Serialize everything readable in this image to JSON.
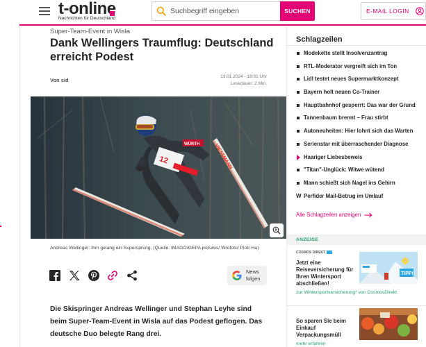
{
  "header": {
    "brand_name": "t-online",
    "brand_tagline": "Nachrichten für Deutschland",
    "search_placeholder": "Suchbegriff eingeben",
    "search_button": "SUCHEN",
    "login_label": "E-MAIL LOGIN",
    "brand_color": "#e20074"
  },
  "article": {
    "kicker": "Super-Team-Event in Wisla",
    "headline": "Dank Wellingers Traumflug: Deutschland erreicht Podest",
    "author": "Von sid",
    "date": "13.01.2024 - 18:01 Uhr",
    "reading_time": "Lesedauer: 2 Min.",
    "image_caption": "Andreas Wellinger: Ihm gelang ein Supersprung. (Quelle: IMAGO/GEPA pictures/ Wrofoto/ Piotr Ha)",
    "teaser": "Die Skispringer Andreas Wellinger und Stephan Leyhe sind beim Super-Team-Event in Wisla auf das Podest geflogen. Das deutsche Duo belegte Rang drei.",
    "bib_number": "12",
    "bib_sponsor": "VIESSMANN",
    "helmet_sponsor": "WÜRTH",
    "share_icons": [
      "facebook-icon",
      "x-icon",
      "pinterest-icon",
      "copy-link-icon",
      "share-icon"
    ],
    "news_button": {
      "line1": "News",
      "line2": "folgen"
    }
  },
  "sidebar": {
    "title": "Schlagzeilen",
    "headlines": [
      {
        "text": "Modekette stellt Insolvenzantrag",
        "marker": "bullet"
      },
      {
        "text": "RTL-Moderator vergreift sich im Ton",
        "marker": "bullet"
      },
      {
        "text": "Lidl testet neues Supermarktkonzept",
        "marker": "bullet"
      },
      {
        "text": "Bayern holt neuen Co-Trainer",
        "marker": "bullet"
      },
      {
        "text": "Hauptbahnhof gesperrt: Das war der Grund",
        "marker": "bullet"
      },
      {
        "text": "Tannenbaum brennt – Frau stirbt",
        "marker": "bullet"
      },
      {
        "text": "Autoneuheiten: Hier lohnt sich das Warten",
        "marker": "bullet"
      },
      {
        "text": "Serienstar mit überraschender Diagnose",
        "marker": "bullet"
      },
      {
        "text": "Haariger Liebesbeweis",
        "marker": "triangle"
      },
      {
        "text": "\"Titan\"-Unglück: Witwe wütend",
        "marker": "bullet"
      },
      {
        "text": "Mann schießt sich Nagel ins Gehirn",
        "marker": "bullet"
      },
      {
        "text": "Perfider Mail-Betrug im Umlauf",
        "marker": "w"
      }
    ],
    "more_link": "Alle Schlagzeilen anzeigen",
    "ads_label": "ANZEIGE",
    "ad1": {
      "brand": "COSMOS DIREKT",
      "text": "Jetzt eine Reiseversicherung für Ihren Wintersport abschließen!",
      "link": "zur Wintersportversicherung* von CosmosDirekt",
      "badge": "TIPP!"
    },
    "ad2": {
      "text": "So sparen Sie beim Einkauf Verpackungsmüll",
      "link": "mehr erfahren"
    }
  }
}
